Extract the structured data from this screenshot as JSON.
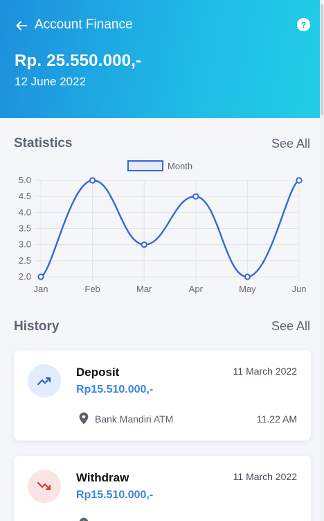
{
  "header": {
    "title": "Account Finance",
    "balance": "Rp. 25.550.000,-",
    "date": "12 June 2022",
    "help_label": "?"
  },
  "statistics": {
    "title": "Statistics",
    "see_all": "See All"
  },
  "chart_data": {
    "type": "line",
    "categories": [
      "Jan",
      "Feb",
      "Mar",
      "Apr",
      "May",
      "Jun"
    ],
    "series": [
      {
        "name": "Month",
        "values": [
          2.0,
          5.0,
          3.0,
          4.5,
          2.0,
          5.0
        ]
      }
    ],
    "y_ticks": [
      "2.0",
      "2.5",
      "3.0",
      "3.5",
      "4.0",
      "4.5",
      "5.0"
    ],
    "ylim": [
      2.0,
      5.0
    ],
    "grid": true,
    "legend": "top-center",
    "color": "#3566d6"
  },
  "history": {
    "title": "History",
    "see_all": "See All",
    "items": [
      {
        "type": "Deposit",
        "amount": "Rp15.510.000,-",
        "date": "11 March 2022",
        "location": "Bank Mandiri ATM",
        "time": "11.22 AM",
        "icon": "trending-up-icon",
        "icon_bg": "#e3ecfb",
        "icon_color": "#2f5fcf"
      },
      {
        "type": "Withdraw",
        "amount": "Rp15.510.000,-",
        "date": "11 March 2022",
        "location": "",
        "time": "",
        "icon": "trending-down-icon",
        "icon_bg": "#fde4e4",
        "icon_color": "#d9363e"
      }
    ]
  }
}
